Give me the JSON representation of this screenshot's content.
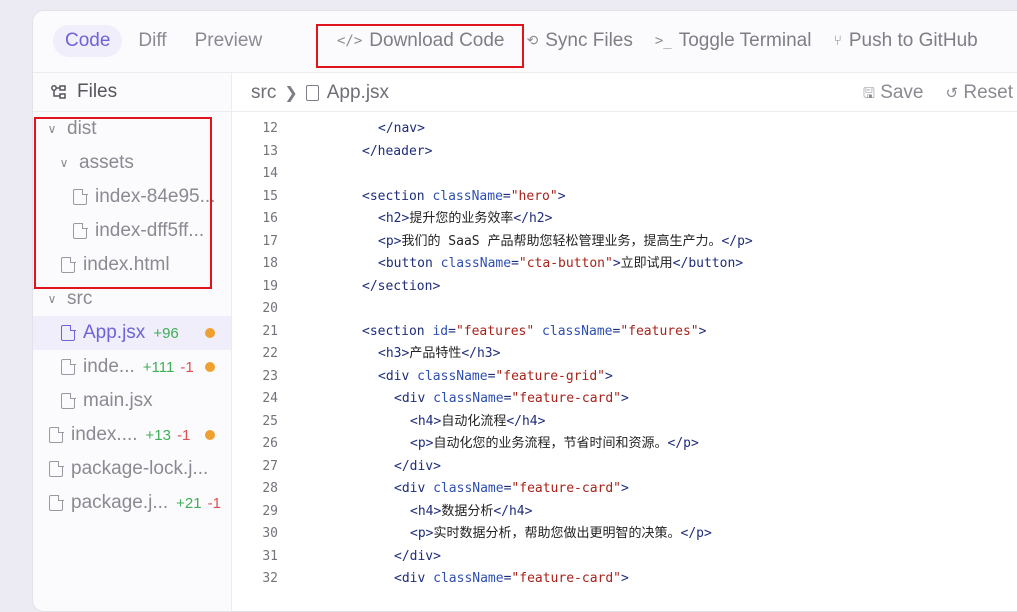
{
  "tabs": [
    "Code",
    "Diff",
    "Preview"
  ],
  "actions": [
    {
      "icon": "</>",
      "label": "Download Code",
      "name": "download-code-button",
      "icon_name": "code-icon"
    },
    {
      "icon": "⟲",
      "label": "Sync Files",
      "name": "sync-files-button",
      "icon_name": "sync-icon"
    },
    {
      "icon": ">_",
      "label": "Toggle Terminal",
      "name": "toggle-terminal-button",
      "icon_name": "terminal-icon"
    },
    {
      "icon": "⑂",
      "label": "Push to GitHub",
      "name": "push-github-button",
      "icon_name": "git-branch-icon"
    }
  ],
  "close_icon": "×",
  "sidebar": {
    "title": "Files",
    "tree": [
      {
        "kind": "folder",
        "label": "dist",
        "indent": 0
      },
      {
        "kind": "folder",
        "label": "assets",
        "indent": 1
      },
      {
        "kind": "file",
        "label": "index-84e95...",
        "indent": 2
      },
      {
        "kind": "file",
        "label": "index-dff5ff...",
        "indent": 2
      },
      {
        "kind": "file",
        "label": "index.html",
        "indent": 1
      },
      {
        "kind": "folder",
        "label": "src",
        "indent": 0
      },
      {
        "kind": "file",
        "label": "App.jsx",
        "indent": 1,
        "active": true,
        "add": "+96",
        "dot": true
      },
      {
        "kind": "file",
        "label": "inde...",
        "indent": 1,
        "add": "+111",
        "del": "-1",
        "dot": true
      },
      {
        "kind": "file",
        "label": "main.jsx",
        "indent": 1
      },
      {
        "kind": "file",
        "label": "index....",
        "indent": 0,
        "add": "+13",
        "del": "-1",
        "dot": true
      },
      {
        "kind": "file",
        "label": "package-lock.j...",
        "indent": 0
      },
      {
        "kind": "file",
        "label": "package.j...",
        "indent": 0,
        "add": "+21",
        "del": "-1"
      }
    ]
  },
  "editor": {
    "crumb_dir": "src",
    "crumb_file": "App.jsx",
    "save_label": "Save",
    "reset_label": "Reset",
    "lines": [
      {
        "n": "12",
        "indent": 2,
        "parts": [
          [
            "t",
            "</nav>"
          ]
        ]
      },
      {
        "n": "13",
        "indent": 1,
        "parts": [
          [
            "t",
            "</header>"
          ]
        ]
      },
      {
        "n": "14",
        "indent": 0,
        "parts": []
      },
      {
        "n": "15",
        "indent": 1,
        "parts": [
          [
            "t",
            "<section "
          ],
          [
            "a",
            "className"
          ],
          [
            "t",
            "="
          ],
          [
            "s",
            "\"hero\""
          ],
          [
            "t",
            ">"
          ]
        ]
      },
      {
        "n": "16",
        "indent": 2,
        "parts": [
          [
            "t",
            "<h2>"
          ],
          [
            "x",
            "提升您的业务效率"
          ],
          [
            "t",
            "</h2>"
          ]
        ]
      },
      {
        "n": "17",
        "indent": 2,
        "parts": [
          [
            "t",
            "<p>"
          ],
          [
            "x",
            "我们的 SaaS 产品帮助您轻松管理业务，提高生产力。"
          ],
          [
            "t",
            "</p>"
          ]
        ]
      },
      {
        "n": "18",
        "indent": 2,
        "parts": [
          [
            "t",
            "<button "
          ],
          [
            "a",
            "className"
          ],
          [
            "t",
            "="
          ],
          [
            "s",
            "\"cta-button\""
          ],
          [
            "t",
            ">"
          ],
          [
            "x",
            "立即试用"
          ],
          [
            "t",
            "</button>"
          ]
        ]
      },
      {
        "n": "19",
        "indent": 1,
        "parts": [
          [
            "t",
            "</section>"
          ]
        ]
      },
      {
        "n": "20",
        "indent": 0,
        "parts": []
      },
      {
        "n": "21",
        "indent": 1,
        "parts": [
          [
            "t",
            "<section "
          ],
          [
            "a",
            "id"
          ],
          [
            "t",
            "="
          ],
          [
            "s",
            "\"features\""
          ],
          [
            "t",
            " "
          ],
          [
            "a",
            "className"
          ],
          [
            "t",
            "="
          ],
          [
            "s",
            "\"features\""
          ],
          [
            "t",
            ">"
          ]
        ]
      },
      {
        "n": "22",
        "indent": 2,
        "parts": [
          [
            "t",
            "<h3>"
          ],
          [
            "x",
            "产品特性"
          ],
          [
            "t",
            "</h3>"
          ]
        ]
      },
      {
        "n": "23",
        "indent": 2,
        "parts": [
          [
            "t",
            "<div "
          ],
          [
            "a",
            "className"
          ],
          [
            "t",
            "="
          ],
          [
            "s",
            "\"feature-grid\""
          ],
          [
            "t",
            ">"
          ]
        ]
      },
      {
        "n": "24",
        "indent": 3,
        "parts": [
          [
            "t",
            "<div "
          ],
          [
            "a",
            "className"
          ],
          [
            "t",
            "="
          ],
          [
            "s",
            "\"feature-card\""
          ],
          [
            "t",
            ">"
          ]
        ]
      },
      {
        "n": "25",
        "indent": 4,
        "parts": [
          [
            "t",
            "<h4>"
          ],
          [
            "x",
            "自动化流程"
          ],
          [
            "t",
            "</h4>"
          ]
        ]
      },
      {
        "n": "26",
        "indent": 4,
        "parts": [
          [
            "t",
            "<p>"
          ],
          [
            "x",
            "自动化您的业务流程，节省时间和资源。"
          ],
          [
            "t",
            "</p>"
          ]
        ]
      },
      {
        "n": "27",
        "indent": 3,
        "parts": [
          [
            "t",
            "</div>"
          ]
        ]
      },
      {
        "n": "28",
        "indent": 3,
        "parts": [
          [
            "t",
            "<div "
          ],
          [
            "a",
            "className"
          ],
          [
            "t",
            "="
          ],
          [
            "s",
            "\"feature-card\""
          ],
          [
            "t",
            ">"
          ]
        ]
      },
      {
        "n": "29",
        "indent": 4,
        "parts": [
          [
            "t",
            "<h4>"
          ],
          [
            "x",
            "数据分析"
          ],
          [
            "t",
            "</h4>"
          ]
        ]
      },
      {
        "n": "30",
        "indent": 4,
        "parts": [
          [
            "t",
            "<p>"
          ],
          [
            "x",
            "实时数据分析，帮助您做出更明智的决策。"
          ],
          [
            "t",
            "</p>"
          ]
        ]
      },
      {
        "n": "31",
        "indent": 3,
        "parts": [
          [
            "t",
            "</div>"
          ]
        ]
      },
      {
        "n": "32",
        "indent": 3,
        "parts": [
          [
            "t",
            "<div "
          ],
          [
            "a",
            "className"
          ],
          [
            "t",
            "="
          ],
          [
            "s",
            "\"feature-card\""
          ],
          [
            "t",
            ">"
          ]
        ]
      }
    ]
  },
  "colors": {
    "accent": "#6f63d9",
    "highlight_box": "#e0141d",
    "added": "#3fae57",
    "removed": "#e05050",
    "modified_dot": "#f0a030"
  }
}
